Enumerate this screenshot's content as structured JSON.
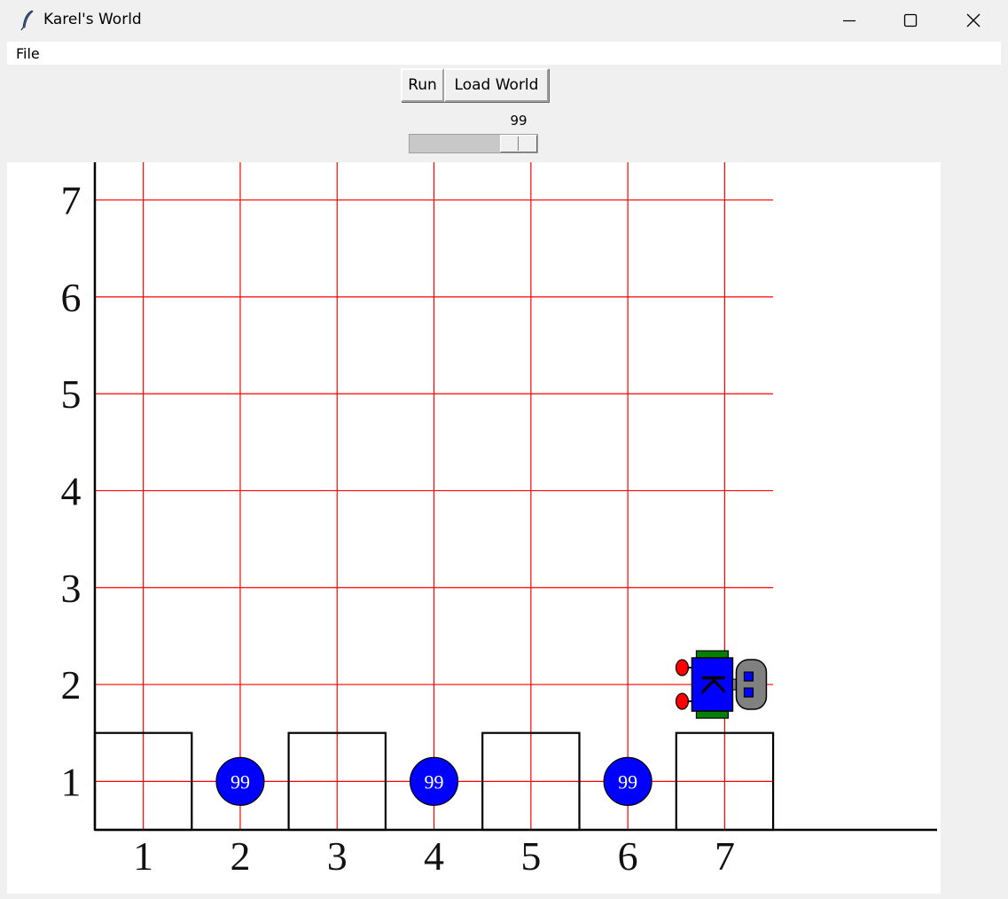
{
  "window": {
    "title": "Karel's World",
    "icon": "feather-icon",
    "controls": [
      "minimize-icon",
      "maximize-icon",
      "close-icon"
    ]
  },
  "menu": {
    "items": [
      "File"
    ]
  },
  "toolbar": {
    "run_label": "Run",
    "load_world_label": "Load World"
  },
  "speed": {
    "value": "99",
    "max": 100
  },
  "world": {
    "x_labels": [
      "1",
      "2",
      "3",
      "4",
      "5",
      "6",
      "7"
    ],
    "y_labels": [
      "1",
      "2",
      "3",
      "4",
      "5",
      "6",
      "7"
    ],
    "grid_color": "#ff0000",
    "walls": [
      {
        "avenue": 1,
        "street": 1
      },
      {
        "avenue": 3,
        "street": 1
      },
      {
        "avenue": 5,
        "street": 1
      },
      {
        "avenue": 7,
        "street": 1
      }
    ],
    "beepers": [
      {
        "avenue": 2,
        "street": 1,
        "count": "99"
      },
      {
        "avenue": 4,
        "street": 1,
        "count": "99"
      },
      {
        "avenue": 6,
        "street": 1,
        "count": "99"
      }
    ],
    "beeper_color": "#0000ff",
    "karel": {
      "avenue": 7,
      "street": 2,
      "facing": "east",
      "label": "K"
    }
  }
}
